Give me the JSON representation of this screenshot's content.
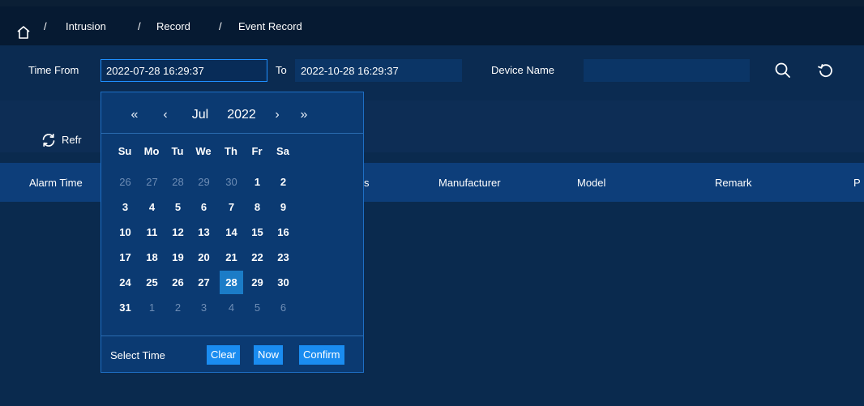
{
  "breadcrumb": {
    "items": [
      "Intrusion",
      "Record",
      "Event Record"
    ],
    "separator": "/"
  },
  "filters": {
    "time_from_label": "Time From",
    "time_from_value": "2022-07-28 16:29:37",
    "to_label": "To",
    "time_to_value": "2022-10-28 16:29:37",
    "device_name_label": "Device Name",
    "device_name_value": ""
  },
  "toolbar": {
    "refresh_label": "Refr"
  },
  "table": {
    "columns": [
      "Alarm Time",
      "s",
      "Manufacturer",
      "Model",
      "Remark",
      "P"
    ]
  },
  "date_picker": {
    "nav": {
      "prev_year": "«",
      "prev_month": "‹",
      "next_month": "›",
      "next_year": "»"
    },
    "month": "Jul",
    "year": "2022",
    "weekdays": [
      "Su",
      "Mo",
      "Tu",
      "We",
      "Th",
      "Fr",
      "Sa"
    ],
    "weeks": [
      [
        {
          "d": "26",
          "muted": true
        },
        {
          "d": "27",
          "muted": true
        },
        {
          "d": "28",
          "muted": true
        },
        {
          "d": "29",
          "muted": true
        },
        {
          "d": "30",
          "muted": true
        },
        {
          "d": "1"
        },
        {
          "d": "2"
        }
      ],
      [
        {
          "d": "3"
        },
        {
          "d": "4"
        },
        {
          "d": "5"
        },
        {
          "d": "6"
        },
        {
          "d": "7"
        },
        {
          "d": "8"
        },
        {
          "d": "9"
        }
      ],
      [
        {
          "d": "10"
        },
        {
          "d": "11"
        },
        {
          "d": "12"
        },
        {
          "d": "13"
        },
        {
          "d": "14"
        },
        {
          "d": "15"
        },
        {
          "d": "16"
        }
      ],
      [
        {
          "d": "17"
        },
        {
          "d": "18"
        },
        {
          "d": "19"
        },
        {
          "d": "20"
        },
        {
          "d": "21"
        },
        {
          "d": "22"
        },
        {
          "d": "23"
        }
      ],
      [
        {
          "d": "24"
        },
        {
          "d": "25"
        },
        {
          "d": "26"
        },
        {
          "d": "27"
        },
        {
          "d": "28",
          "selected": true
        },
        {
          "d": "29"
        },
        {
          "d": "30"
        }
      ],
      [
        {
          "d": "31"
        },
        {
          "d": "1",
          "muted": true
        },
        {
          "d": "2",
          "muted": true
        },
        {
          "d": "3",
          "muted": true
        },
        {
          "d": "4",
          "muted": true
        },
        {
          "d": "5",
          "muted": true
        },
        {
          "d": "6",
          "muted": true
        }
      ]
    ],
    "select_time_label": "Select Time",
    "buttons": {
      "clear": "Clear",
      "now": "Now",
      "confirm": "Confirm"
    }
  },
  "icons": {
    "home": "home-icon",
    "search": "search-icon",
    "reset": "reset-icon",
    "refresh": "refresh-icon"
  },
  "colors": {
    "background": "#0a2a4e",
    "accent": "#1a8cf0",
    "selected_day": "#1b7cc7",
    "table_header": "#0d3e7a"
  }
}
